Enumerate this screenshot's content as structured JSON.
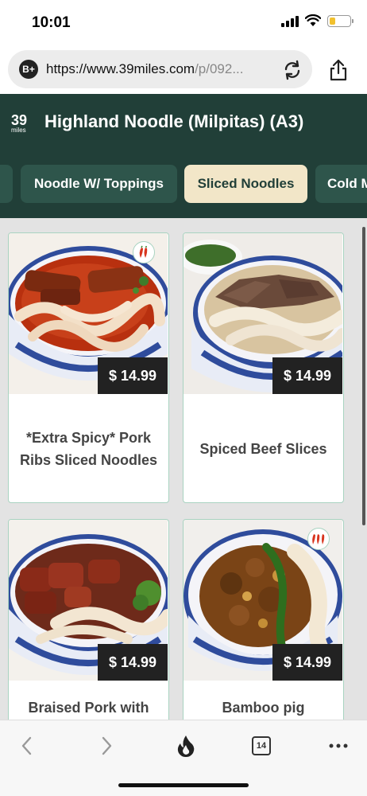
{
  "status_bar": {
    "time": "10:01"
  },
  "browser": {
    "url_icon_label": "B+",
    "url_host": "https://www.39miles.com",
    "url_path": "/p/092..."
  },
  "header": {
    "logo_number": "39",
    "logo_sub": "miles",
    "title": "Highland Noodle (Milpitas) (A3)"
  },
  "tabs": [
    {
      "label": ""
    },
    {
      "label": "Noodle W/ Toppings"
    },
    {
      "label": "Sliced Noodles",
      "active": true
    },
    {
      "label": "Cold M"
    }
  ],
  "products": [
    {
      "name": "*Extra Spicy* Pork Ribs Sliced Noodles",
      "price": "$ 14.99",
      "spicy_level": 2
    },
    {
      "name": "Spiced Beef Slices",
      "price": "$ 14.99",
      "spicy_level": 0
    },
    {
      "name": "Braised Pork with",
      "price": "$ 14.99",
      "spicy_level": 0
    },
    {
      "name": "Bamboo pig intestine",
      "price": "$ 14.99",
      "spicy_level": 3
    }
  ],
  "bottom_toolbar": {
    "tab_count": "14"
  },
  "colors": {
    "header_bg": "#213f38",
    "tab_bg": "#2e554b",
    "active_tab_bg": "#f2e6c8",
    "card_border": "#a9d3c1",
    "price_bg": "#222222",
    "flame_accent": "#222222"
  }
}
